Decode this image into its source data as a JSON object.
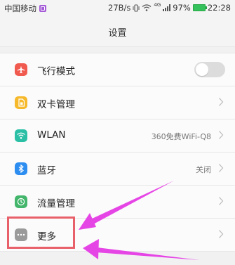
{
  "status_bar": {
    "carrier": "中国移动",
    "net_speed": "27B/s",
    "network_tag": "4G",
    "battery": "97%",
    "time": "22:28"
  },
  "header": {
    "title": "设置"
  },
  "settings": [
    {
      "label": "飞行模式",
      "icon": "airplane-icon",
      "color": "#f05a4f",
      "control": "toggle",
      "on": false
    },
    {
      "label": "双卡管理",
      "icon": "sim-card-icon",
      "color": "#f6b92b",
      "control": "chevron"
    },
    {
      "label": "WLAN",
      "icon": "wifi-icon",
      "color": "#2bbfa6",
      "control": "chevron",
      "value": "360免费WiFi-Q8"
    },
    {
      "label": "蓝牙",
      "icon": "bluetooth-icon",
      "color": "#2d8df0",
      "control": "chevron",
      "value": "关闭"
    },
    {
      "label": "流量管理",
      "icon": "data-usage-icon",
      "color": "#43b66b",
      "control": "chevron"
    },
    {
      "label": "更多",
      "icon": "more-icon",
      "color": "#9a9a9a",
      "control": "chevron"
    }
  ],
  "annotation_colors": {
    "arrow": "#e645e6",
    "box": "#e8606a"
  }
}
